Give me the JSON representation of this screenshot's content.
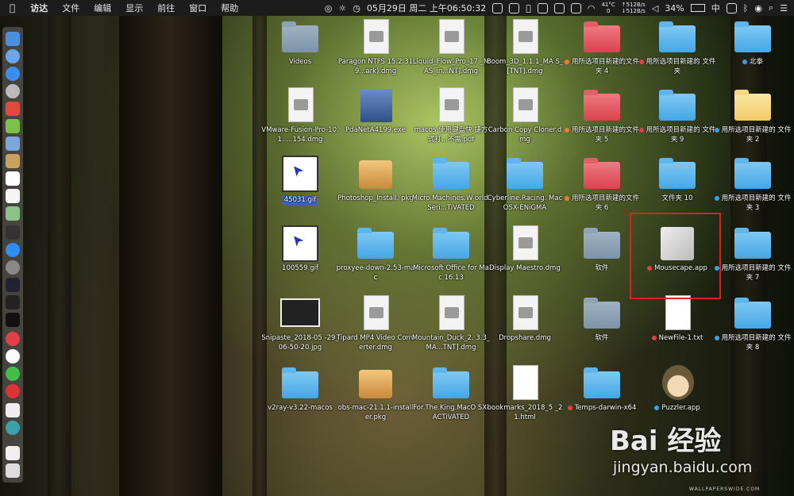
{
  "menubar": {
    "app_name": "访达",
    "menus": [
      "文件",
      "编辑",
      "显示",
      "前往",
      "窗口",
      "帮助"
    ],
    "datetime": "05月29日 周二 上午06:50:32",
    "cpu_temp": "41°C",
    "cpu_fan": "0",
    "net_up": "↑512B/s",
    "net_down": "↓512B/s",
    "battery": "34%",
    "input_method": "中"
  },
  "desktop": [
    {
      "label": "Videos",
      "icon": "folder-icon",
      "style": "grey"
    },
    {
      "label": "Paragon NTFS 15.2.319...ark).dmg",
      "icon": "disk-image-icon"
    },
    {
      "label": "Liquid_Flow_Pro_17 _MAS_in...NT].dmg",
      "icon": "disk-image-icon"
    },
    {
      "label": "Boom_3D_1.1.1_MA S_[TNT].dmg",
      "icon": "disk-image-icon"
    },
    {
      "label": "用所选项目新建的文件夹 4",
      "icon": "folder-icon",
      "style": "red",
      "tag": "#f07a30"
    },
    {
      "label": "用所选项目新建的 文件夹",
      "icon": "folder-icon",
      "tag": "#e04040"
    },
    {
      "label": "北拳",
      "icon": "folder-icon",
      "tag": "#3ca0e6"
    },
    {
      "label": "VMware-Fusion-Pro-10.1.....154.dmg",
      "icon": "disk-image-icon"
    },
    {
      "label": "PdaNetA4199.exe",
      "icon": "exe-icon"
    },
    {
      "label": "macos 使用键盘快 捷方式打...不需.pdf",
      "icon": "pdf-icon"
    },
    {
      "label": "Carbon Copy Cloner.dmg",
      "icon": "disk-image-icon"
    },
    {
      "label": "用所选项目新建的文件夹 5",
      "icon": "folder-icon",
      "style": "red",
      "tag": "#f07a30"
    },
    {
      "label": "用所选项目新建的 文件夹 9",
      "icon": "folder-icon",
      "tag": "#e04040"
    },
    {
      "label": "用所选项目新建的 文件夹 2",
      "icon": "folder-icon",
      "style": "yel",
      "tag": "#3ca0e6"
    },
    {
      "label": "45031.gif",
      "icon": "gif-icon",
      "selected": true
    },
    {
      "label": "Photoshop_Install. pkg",
      "icon": "package-icon"
    },
    {
      "label": "Micro.Machines.W orld.Seri...TiVATED",
      "icon": "folder-icon"
    },
    {
      "label": "Cyberline.Racing. MacOSX-ENiGMA",
      "icon": "folder-icon"
    },
    {
      "label": "用所选项目新建的文件夹 6",
      "icon": "folder-icon",
      "style": "red",
      "tag": "#f07a30"
    },
    {
      "label": "文件夹 10",
      "icon": "folder-icon"
    },
    {
      "label": "用所选项目新建的 文件夹 3",
      "icon": "folder-icon",
      "tag": "#3ca0e6"
    },
    {
      "label": "100559.gif",
      "icon": "gif-icon"
    },
    {
      "label": "proxyee-down-2.53-mac",
      "icon": "folder-icon"
    },
    {
      "label": "Microsoft Office for Mac 16.13",
      "icon": "folder-icon"
    },
    {
      "label": "Display Maestro.dmg",
      "icon": "disk-image-icon"
    },
    {
      "label": "软件",
      "icon": "folder-icon",
      "style": "grey"
    },
    {
      "label": "Mousecape.app",
      "icon": "app-icon",
      "tag": "#e04040"
    },
    {
      "label": "用所选项目新建的 文件夹 7",
      "icon": "folder-icon",
      "tag": "#3ca0e6"
    },
    {
      "label": "Snipaste_2018-05 -29_06-50-20.jpg",
      "icon": "screenshot-icon"
    },
    {
      "label": "Tipard MP4 Video Converter.dmg",
      "icon": "disk-image-icon"
    },
    {
      "label": "Mountain_Duck_2. 3.3_MA...TNT].dmg",
      "icon": "disk-image-icon"
    },
    {
      "label": "Dropshare.dmg",
      "icon": "disk-image-icon"
    },
    {
      "label": "软件",
      "icon": "folder-icon",
      "style": "grey"
    },
    {
      "label": "NewFile-1.txt",
      "icon": "txt-icon",
      "tag": "#e04040"
    },
    {
      "label": "用所选项目新建的 文件夹 8",
      "icon": "folder-icon",
      "tag": "#3ca0e6"
    },
    {
      "label": "v2ray-v3.22-macos",
      "icon": "folder-icon"
    },
    {
      "label": "obs-mac-21.1.1-installer.pkg",
      "icon": "package-icon"
    },
    {
      "label": "For.The.King.MacO SX-ACTiVATED",
      "icon": "folder-icon"
    },
    {
      "label": "bookmarks_2018_5 _21.html",
      "icon": "html-icon"
    },
    {
      "label": "Temps-darwin-x64",
      "icon": "folder-icon",
      "tag": "#e04040"
    },
    {
      "label": "Puzzler.app",
      "icon": "avatar-icon",
      "tag": "#3ca0e6"
    }
  ],
  "watermark": {
    "brand": "Bai 经验",
    "url": "jingyan.baidu.com",
    "wallpaper": "WALLPAPERSWIDE.COM"
  }
}
